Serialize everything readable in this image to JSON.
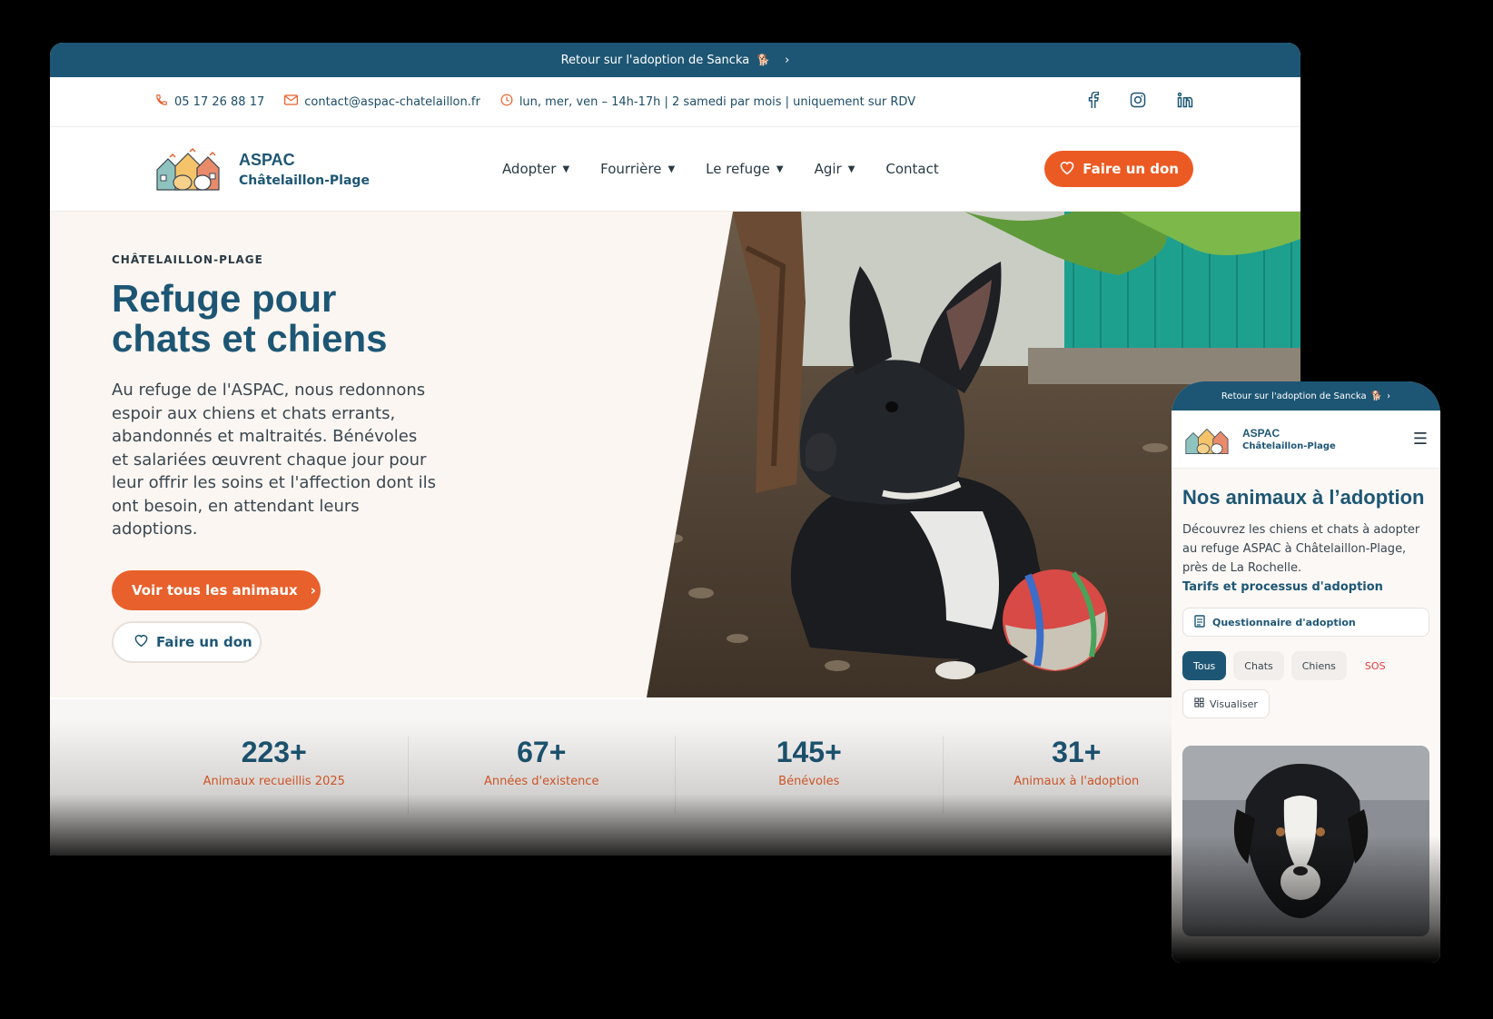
{
  "desktop": {
    "banner": {
      "text": "Retour sur l'adoption de Sancka",
      "emoji_icon": "dog-emoji-icon",
      "chevron": "›"
    },
    "contact_bar": {
      "phone": "05 17 26 88 17",
      "email": "contact@aspac-chatelaillon.fr",
      "hours": "lun, mer, ven – 14h-17h | 2 samedi par mois | uniquement sur RDV",
      "socials": [
        "facebook-icon",
        "instagram-icon",
        "linkedin-icon"
      ]
    },
    "nav": {
      "logo_title": "ASPAC",
      "logo_subtitle": "Châtelaillon-Plage",
      "links": [
        "Adopter",
        "Fourrière",
        "Le refuge",
        "Agir",
        "Contact"
      ],
      "donate": "Faire un don"
    },
    "hero": {
      "eyebrow": "CHÂTELAILLON-PLAGE",
      "title_line1": "Refuge pour",
      "title_line2": "chats et chiens",
      "body": "Au refuge de l'ASPAC, nous redonnons espoir aux chiens et chats errants, abandonnés et maltraités. Bénévoles et salariées œuvrent chaque jour pour leur offrir les soins et l'affection dont ils ont besoin, en attendant leurs adoptions.",
      "cta_primary": "Voir tous les animaux",
      "cta_secondary": "Faire un don"
    },
    "stats": [
      {
        "value": "223+",
        "label": "Animaux recueillis 2025"
      },
      {
        "value": "67+",
        "label": "Années d'existence"
      },
      {
        "value": "145+",
        "label": "Bénévoles"
      },
      {
        "value": "31+",
        "label": "Animaux à l'adoption"
      }
    ]
  },
  "mobile": {
    "banner": "Retour sur l'adoption de Sancka",
    "logo_title": "ASPAC",
    "logo_subtitle": "Châtelaillon-Plage",
    "title": "Nos animaux à l’adoption",
    "description": "Découvrez les chiens et chats à adopter au refuge ASPAC à Châtelaillon-Plage, près de La Rochelle.",
    "link": "Tarifs et processus d'adoption",
    "questionnaire": "Questionnaire d'adoption",
    "filters": [
      "Tous",
      "Chats",
      "Chiens",
      "SOS"
    ],
    "active_filter": "Tous",
    "view": "Visualiser"
  },
  "colors": {
    "brand_blue": "#1d5674",
    "accent_orange": "#e8602c",
    "sos_red": "#e23b3b"
  }
}
